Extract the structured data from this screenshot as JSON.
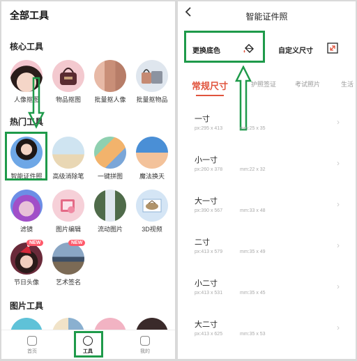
{
  "left": {
    "page_title": "全部工具",
    "sections": {
      "core": "核心工具",
      "hot": "热门工具",
      "picture": "图片工具"
    },
    "core_tools": [
      {
        "label": "人像抠图"
      },
      {
        "label": "物品抠图"
      },
      {
        "label": "批量抠人像"
      },
      {
        "label": "批量抠物品"
      }
    ],
    "hot_tools_row1": [
      {
        "label": "智能证件照"
      },
      {
        "label": "高级消除笔"
      },
      {
        "label": "一键拼图"
      },
      {
        "label": "魔法换天"
      }
    ],
    "hot_tools_row2": [
      {
        "label": "滤镜"
      },
      {
        "label": "图片编辑"
      },
      {
        "label": "流动图片"
      },
      {
        "label": "3D视频"
      }
    ],
    "hot_tools_row3": [
      {
        "label": "节日头像",
        "badge": "NEW"
      },
      {
        "label": "艺术签名",
        "badge": "NEW"
      }
    ],
    "bottom_nav": [
      {
        "label": "首页"
      },
      {
        "label": "工具"
      },
      {
        "label": "我的"
      }
    ]
  },
  "right": {
    "title": "智能证件照",
    "back_icon": "chevron-left-icon",
    "option_bg": "更换底色",
    "option_custom": "自定义尺寸",
    "tabs": [
      "常规尺寸",
      "护照签证",
      "考试照片",
      "生活"
    ],
    "sizes": [
      {
        "name": "一寸",
        "px": "px:295 x 413",
        "mm": "mm:25 x 35"
      },
      {
        "name": "小一寸",
        "px": "px:260 x 378",
        "mm": "mm:22 x 32"
      },
      {
        "name": "大一寸",
        "px": "px:390 x 567",
        "mm": "mm:33 x 48"
      },
      {
        "name": "二寸",
        "px": "px:413 x 579",
        "mm": "mm:35 x 49"
      },
      {
        "name": "小二寸",
        "px": "px:413 x 531",
        "mm": "mm:35 x 45"
      },
      {
        "name": "大二寸",
        "px": "px:413 x 625",
        "mm": "mm:35 x 53"
      }
    ]
  },
  "colors": {
    "accent": "#e0543d",
    "highlight": "#1e9a4a"
  }
}
